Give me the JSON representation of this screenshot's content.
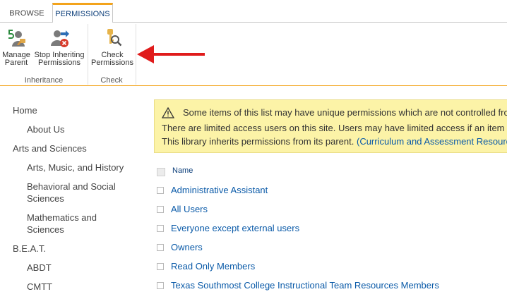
{
  "ribbon": {
    "tabs": [
      "BROWSE",
      "PERMISSIONS"
    ],
    "active_tab": "PERMISSIONS",
    "buttons": {
      "manage_parent": "Manage\nParent",
      "stop_inheriting": "Stop Inheriting\nPermissions",
      "check_permissions": "Check\nPermissions"
    },
    "groups": [
      "Inheritance",
      "Check"
    ]
  },
  "nav": {
    "items": [
      {
        "label": "Home",
        "level": 0
      },
      {
        "label": "About Us",
        "level": 1
      },
      {
        "label": "Arts and Sciences",
        "level": 0
      },
      {
        "label": "Arts, Music, and History",
        "level": 1
      },
      {
        "label": "Behavioral and Social Sciences",
        "level": 1
      },
      {
        "label": "Mathematics and Sciences",
        "level": 1
      },
      {
        "label": "B.E.A.T.",
        "level": 0
      },
      {
        "label": "ABDT",
        "level": 1
      },
      {
        "label": "CMTT",
        "level": 1
      }
    ]
  },
  "banner": {
    "line1": "Some items of this list may have unique permissions which are not controlled fro",
    "line2": "There are limited access users on this site. Users may have limited access if an item or",
    "line3_text": "This library inherits permissions from its parent. ",
    "line3_link": "(Curriculum and Assessment Resource"
  },
  "permissions": {
    "column_header": "Name",
    "rows": [
      "Administrative Assistant",
      "All Users",
      "Everyone except external users",
      "Owners",
      "Read Only Members",
      "Texas Southmost College Instructional Team Resources Members"
    ]
  },
  "colors": {
    "accent_orange": "#f3a31b",
    "link_blue": "#0a5aa8",
    "banner_yellow": "#fcf3a7",
    "annotation_red": "#e01b1b"
  },
  "icons": [
    "manage-parent-icon",
    "stop-inheriting-icon",
    "check-permissions-icon",
    "warning-icon",
    "red-arrow-annotation"
  ]
}
